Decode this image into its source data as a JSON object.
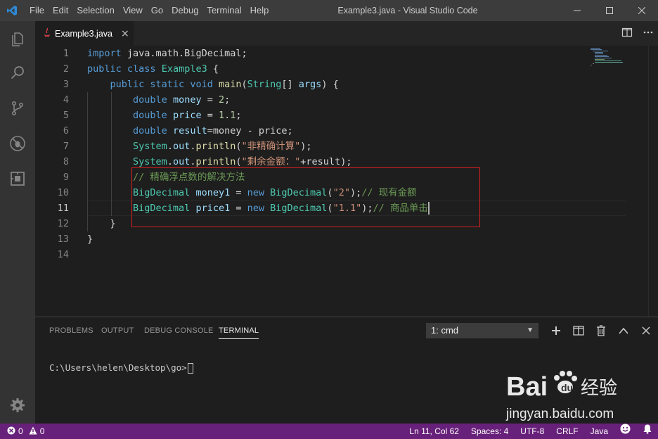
{
  "window": {
    "title": "Example3.java - Visual Studio Code",
    "menu": [
      "File",
      "Edit",
      "Selection",
      "View",
      "Go",
      "Debug",
      "Terminal",
      "Help"
    ]
  },
  "tab": {
    "filename": "Example3.java",
    "close_glyph": "×"
  },
  "editor": {
    "active_line": 11,
    "line_numbers": [
      "1",
      "2",
      "3",
      "4",
      "5",
      "6",
      "7",
      "8",
      "9",
      "10",
      "11",
      "12",
      "13",
      "14"
    ],
    "lines": [
      [
        {
          "t": "import ",
          "c": "kw"
        },
        {
          "t": "java.math.BigDecimal;",
          "c": "pl"
        }
      ],
      [
        {
          "t": "public ",
          "c": "kw"
        },
        {
          "t": "class ",
          "c": "kw"
        },
        {
          "t": "Example3",
          "c": "ty"
        },
        {
          "t": " {",
          "c": "pl"
        }
      ],
      [
        {
          "t": "    "
        },
        {
          "t": "public ",
          "c": "kw"
        },
        {
          "t": "static ",
          "c": "kw"
        },
        {
          "t": "void ",
          "c": "kw"
        },
        {
          "t": "main",
          "c": "fn"
        },
        {
          "t": "(",
          "c": "pl"
        },
        {
          "t": "String",
          "c": "ty"
        },
        {
          "t": "[] ",
          "c": "pl"
        },
        {
          "t": "args",
          "c": "vr"
        },
        {
          "t": ") {",
          "c": "pl"
        }
      ],
      [
        {
          "t": "        "
        },
        {
          "t": "double ",
          "c": "kw"
        },
        {
          "t": "money",
          "c": "vr"
        },
        {
          "t": " = ",
          "c": "pl"
        },
        {
          "t": "2",
          "c": "nm"
        },
        {
          "t": ";",
          "c": "pl"
        }
      ],
      [
        {
          "t": "        "
        },
        {
          "t": "double ",
          "c": "kw"
        },
        {
          "t": "price",
          "c": "vr"
        },
        {
          "t": " = ",
          "c": "pl"
        },
        {
          "t": "1.1",
          "c": "nm"
        },
        {
          "t": ";",
          "c": "pl"
        }
      ],
      [
        {
          "t": "        "
        },
        {
          "t": "double ",
          "c": "kw"
        },
        {
          "t": "result",
          "c": "vr"
        },
        {
          "t": "=money - price;",
          "c": "pl"
        }
      ],
      [
        {
          "t": "        "
        },
        {
          "t": "System",
          "c": "ty"
        },
        {
          "t": ".",
          "c": "pl"
        },
        {
          "t": "out",
          "c": "vr"
        },
        {
          "t": ".",
          "c": "pl"
        },
        {
          "t": "println",
          "c": "fn"
        },
        {
          "t": "(",
          "c": "pl"
        },
        {
          "t": "\"非精确计算\"",
          "c": "st"
        },
        {
          "t": ");",
          "c": "pl"
        }
      ],
      [
        {
          "t": "        "
        },
        {
          "t": "System",
          "c": "ty"
        },
        {
          "t": ".",
          "c": "pl"
        },
        {
          "t": "out",
          "c": "vr"
        },
        {
          "t": ".",
          "c": "pl"
        },
        {
          "t": "println",
          "c": "fn"
        },
        {
          "t": "(",
          "c": "pl"
        },
        {
          "t": "\"剩余金额：\"",
          "c": "st"
        },
        {
          "t": "+result);",
          "c": "pl"
        }
      ],
      [
        {
          "t": "        "
        },
        {
          "t": "// 精确浮点数的解决方法",
          "c": "cm"
        }
      ],
      [
        {
          "t": "        "
        },
        {
          "t": "BigDecimal",
          "c": "ty"
        },
        {
          "t": " ",
          "c": "pl"
        },
        {
          "t": "money1",
          "c": "vr"
        },
        {
          "t": " = ",
          "c": "pl"
        },
        {
          "t": "new ",
          "c": "kw"
        },
        {
          "t": "BigDecimal",
          "c": "ty"
        },
        {
          "t": "(",
          "c": "pl"
        },
        {
          "t": "\"2\"",
          "c": "st"
        },
        {
          "t": ");",
          "c": "pl"
        },
        {
          "t": "// 现有金额",
          "c": "cm"
        }
      ],
      [
        {
          "t": "        "
        },
        {
          "t": "BigDecimal",
          "c": "ty"
        },
        {
          "t": " ",
          "c": "pl"
        },
        {
          "t": "price1",
          "c": "vr"
        },
        {
          "t": " = ",
          "c": "pl"
        },
        {
          "t": "new ",
          "c": "kw"
        },
        {
          "t": "BigDecimal",
          "c": "ty"
        },
        {
          "t": "(",
          "c": "pl"
        },
        {
          "t": "\"1.1\"",
          "c": "st"
        },
        {
          "t": ");",
          "c": "pl"
        },
        {
          "t": "// 商品单击",
          "c": "cm"
        }
      ],
      [
        {
          "t": "    }",
          "c": "pl"
        }
      ],
      [
        {
          "t": "}",
          "c": "pl"
        }
      ],
      []
    ]
  },
  "panel": {
    "tabs": [
      "PROBLEMS",
      "OUTPUT",
      "DEBUG CONSOLE",
      "TERMINAL"
    ],
    "active_tab": "TERMINAL",
    "terminal_selector": "1: cmd",
    "terminal_prompt": "C:\\Users\\helen\\Desktop\\go>"
  },
  "statusbar": {
    "errors": "0",
    "warnings": "0",
    "cursor_position": "Ln 11, Col 62",
    "indentation": "Spaces: 4",
    "encoding": "UTF-8",
    "line_ending": "CRLF",
    "language": "Java"
  },
  "watermark": {
    "brand_left": "Bai",
    "brand_right": "经验",
    "url": "jingyan.baidu.com"
  },
  "colors": {
    "statusbar": "#68217a",
    "keyword": "#569cd6",
    "type": "#4ec9b0",
    "function": "#dcdcaa",
    "variable": "#9cdcfe",
    "string": "#ce9178",
    "number": "#b5cea8",
    "comment": "#6a9955",
    "annotation_box": "#d21f1f"
  },
  "icons": [
    "vscode-logo-icon",
    "explorer-icon",
    "search-icon",
    "source-control-icon",
    "debug-icon",
    "extensions-icon",
    "settings-gear-icon",
    "split-editor-icon",
    "more-actions-icon",
    "minimize-icon",
    "maximize-icon",
    "close-icon",
    "new-terminal-icon",
    "split-terminal-icon",
    "kill-terminal-icon",
    "maximize-panel-icon",
    "close-panel-icon",
    "error-icon",
    "warning-icon",
    "feedback-smiley-icon",
    "notifications-bell-icon",
    "java-file-icon"
  ]
}
